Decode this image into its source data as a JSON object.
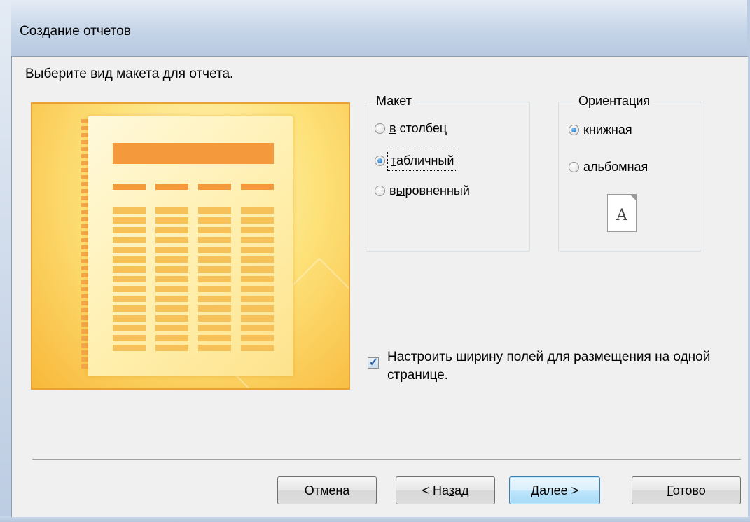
{
  "window": {
    "title": "Создание отчетов"
  },
  "prompt": "Выберите вид макета для отчета.",
  "layout_group": {
    "legend": "Макет",
    "options": [
      {
        "label": "в столбец",
        "accel": "в",
        "rest": " столбец",
        "selected": false
      },
      {
        "label": "табличный",
        "accel": "т",
        "rest": "абличный",
        "selected": true
      },
      {
        "label": "выровненный",
        "accel": "ы",
        "pre": "в",
        "rest": "ровненный",
        "selected": false
      }
    ]
  },
  "orientation_group": {
    "legend": "Ориентация",
    "options": [
      {
        "label": "книжная",
        "accel": "к",
        "rest": "нижная",
        "selected": true
      },
      {
        "label": "альбомная",
        "pre": "ал",
        "accel": "ь",
        "rest": "бомная",
        "selected": false
      }
    ],
    "icon_letter": "A"
  },
  "fit_checkbox": {
    "checked": true,
    "label_pre": "Настроить ",
    "label_accel": "ш",
    "label_rest": "ирину полей для размещения на одной странице."
  },
  "buttons": {
    "cancel": "Отмена",
    "back_pre": "< На",
    "back_accel": "з",
    "back_rest": "ад",
    "next_accel": "Д",
    "next_rest": "алее >",
    "finish_accel": "Г",
    "finish_rest": "отово"
  },
  "colors": {
    "preview_border": "#e8a230",
    "preview_bar": "#f49a3c",
    "preview_cell": "#f7c15a",
    "radio_selected": "#1b64b5"
  }
}
